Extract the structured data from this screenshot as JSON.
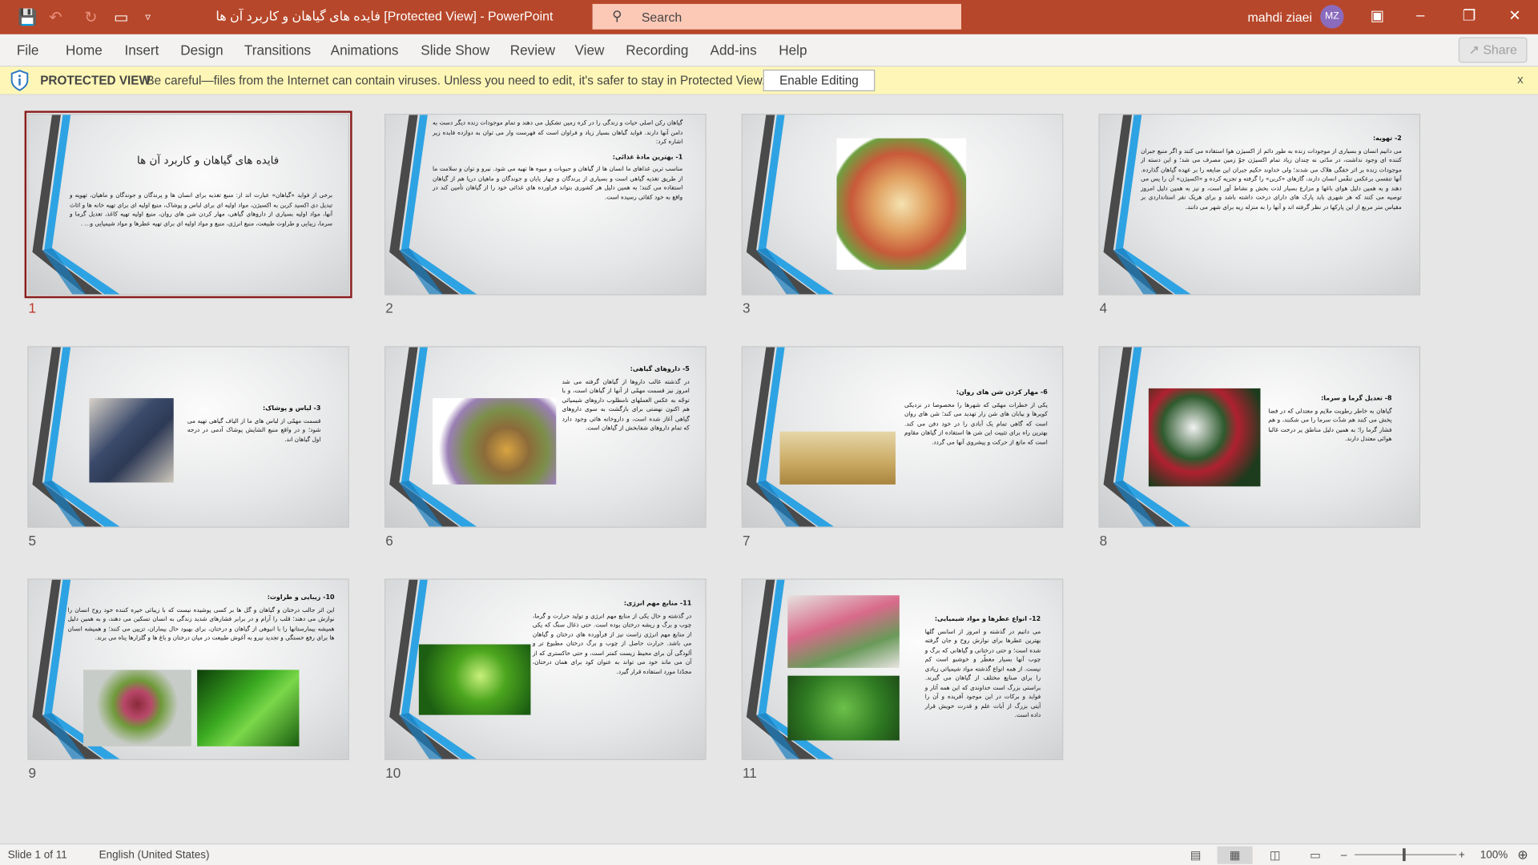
{
  "titlebar": {
    "title": "فایده های گیاهان و کاربرد آن ها [Protected View]  -  PowerPoint",
    "search_placeholder": "Search",
    "user_name": "mahdi ziaei",
    "user_initials": "MZ",
    "accent": "#b7472a"
  },
  "quick_access": {
    "icons": [
      "save-icon",
      "undo-icon",
      "redo-icon",
      "present-icon",
      "customize-icon"
    ]
  },
  "menu": {
    "items": [
      "File",
      "Home",
      "Insert",
      "Design",
      "Transitions",
      "Animations",
      "Slide Show",
      "Review",
      "View",
      "Recording",
      "Add-ins",
      "Help"
    ],
    "share_label": "Share"
  },
  "protected_view": {
    "label": "PROTECTED VIEW",
    "message": "Be careful—files from the Internet can contain viruses. Unless you need to edit, it's safer to stay in Protected View.",
    "enable_label": "Enable Editing",
    "close_label": "x"
  },
  "slides": [
    {
      "number": "1",
      "selected": true,
      "title": "فایده های گیاهان و کاربرد آن ها",
      "heading": "",
      "body": "برخی از فواید «گیاهان» عبارت اند از: منبع تغذیه برای انسان ها و پرندگان و جوندگان و ماهیان، تهویه و تبدیل دی اکسید کربن به اکسیژن، مواد اولیه ای برای لباس و پوشاک، منبع اولیه ای برای تهیه خانه ها و اثاث آنها، مواد اولیه بسیاری از داروهای گیاهی، مهار کردن شن های روان، منبع اولیه تهیه کاغذ، تعدیل گرما و سرما، زیبایی و طراوت طبیعت، منبع انرژی، منبع و مواد اولیه ای برای تهیه عطرها و مواد شیمیایی و... ."
    },
    {
      "number": "2",
      "heading": "1- بهترین مادهٔ غذائی:",
      "intro": "گیاهان رکن اصلی حیات و زندگی را در کره زمین تشکیل می دهند و تمام موجودات زنده دیگر دست به دامن آنها دارند. فواید گیاهان بسیار زیاد و فراوان است که فهرست وار می توان به دوازده فایده زیر اشاره کرد:",
      "body": "مناسب ترین غذاهای ما انسان ها از گیاهان و حبوبات و میوه ها تهیه می شود. نیرو و توان و سلامت ما از طریق تغذیه گیاهی است و بسیاری از پرندگان و چهار پایان و جوندگان و ماهیان دریا هم از گیاهان استفاده می کنند؛ به همین دلیل هر کشوری بتواند فراورده های غذائی خود را از گیاهان تأمین کند در واقع به خود کفائی رسیده است."
    },
    {
      "number": "3",
      "heading": "",
      "body": "",
      "image": "food-wheel-image"
    },
    {
      "number": "4",
      "heading": "2- تهویه:",
      "body": "می دانیم انسان و بسیاری از موجودات زنده به طور دائم از اکسیژن هوا استفاده می کنند و اگر منبع جبران کننده ای وجود نداشت، در مدّتی نه چندان زیاد تمام اکسیژن جوّ زمین مصرف می شد؛ و این دسته از موجودات زنده بر اثر خفگی هلاک می شدند؛ ولی خداوند حکیم جبران این ضایعه را بر عهده گیاهان گذارده. آنها تنفسی برعکس تنفّس انسان دارند، گازهای «کربن» را گرفته و تجزیه کرده و «اکسیژن» آن را پس می دهند و به همین دلیل هوای باغها و مزارع بسیار لذت بخش و نشاط آور است، و نیز به همین دلیل امروز توصیه می کنند که هر شهری باید پارک های دارای درخت داشته باشد و برای هریک نفر استانداردی بر مقیاس متر مربع از این پارکها در نظر گرفته اند و آنها را به منزله ریه برای شهر می دانند."
    },
    {
      "number": "5",
      "heading": "3- لباس و پوشاک:",
      "body": "قسمت مهمّی از لباس های ما از الیاف گیاهی تهیه می شود؛ و در واقع منبع الشاپش پوشاک آدمی در درجه اول گیاهان اند.",
      "image": "clothing-image"
    },
    {
      "number": "6",
      "heading": "5- داروهای گیاهی:",
      "body": "در گذشته غالب داروها از گیاهان گرفته می شد امروز نیز قسمت مهمّی از آنها از گیاهان است، و با توجّه به عکس العملهای نامطلوب داروهای شیمیائی هم اکنون نهضتی برای بازگشت به سوی داروهای گیاهی آغاز شده است، و داروخانه هائی وجود دارد که تمام داروهای شفابخش از گیاهان است.",
      "image": "herbal-medicine-image"
    },
    {
      "number": "7",
      "heading": "6- مهار کردن شن های روان:",
      "body": "یکی از خطرات مهمّی که شهرها را مخصوصا در نزدیکی کویرها و بیابان های شن زار تهدید می کند؛ شن های روان است که گاهی تمام یک آبادی را در خود دفن می کند. بهترین راه برای تثبیت این شن ها استفاده از گیاهان مقاوم است که مانع از حرکت و پیشروی آنها می گردد.",
      "image": "desert-image"
    },
    {
      "number": "8",
      "heading": "8- تعدیل گرما و سرما:",
      "body": "گیاهان به خاطر رطوبت ملایم و معتدلی که در فضا پخش می کنند هم شدّت سرما را می شکنند، و هم فشار گرما را؛ به همین دلیل مناطق پر درخت غالبا هوائی معتدل دارند.",
      "image": "snowy-berries-image"
    },
    {
      "number": "9",
      "heading": "10- زیبایی و طراوت:",
      "body": "این اثر جالب درختان و گیاهان و گل ها بر کسی پوشیده نیست که با زیبائی خیره کننده خود روح انسان را نوازش می دهند؛ قلب را آرام و در برابر فشارهای شدید زندگی به انسان تسکین می دهند، و به همین دلیل همیشه بیمارستانها را با انبوهی از گیاهان و درختان، برای بهبود حال بیماران، تزیین می کنند؛ و همیشه انسان ها برای رفع خستگی و تجدید نیرو به آغوش طبیعت در میان درختان و باغ ها و گلزارها پناه می برند.",
      "image": "fern-and-leaf-images"
    },
    {
      "number": "10",
      "heading": "11- منابع مهم انرژی:",
      "body": "در گذشته و حال یکی از منابع مهم انرژی و تولید حرارت و گرما، چوب و برگ و ریشه درختان بوده است. حتی ذغال سنگ که یکی از منابع مهم انرژی زاست نیز از فرآورده های درختان و گیاهان می باشد. حرارت حاصل از چوب و برگ درختان مطبوع تر و آلودگی آن برای محیط زیست کمتر است، و حتی خاکستری که از آن می ماند خود می تواند به عنوان کود برای همان درختان، مجدّدا مورد استفاده قرار گیرد.",
      "image": "energy-plant-image"
    },
    {
      "number": "11",
      "heading": "12- انواع عطرها و مواد شیمیایی:",
      "body": "می دانیم در گذشته و امروز از اسانس گلها بهترین عطرها برای نوازش روح و جان گرفته شده است؛ و حتی درختانی و گیاهانی که برگ و چوب آنها بسیار معطّر و خوشبو است کم نیست. از همه انواع گذشته مواد شیمیائی زیادی را برای صنایع مختلف از گیاهان می گیرند. براستی بزرگ است خداوندی که این همه آثار و فواید و برکات در این موجود آفریده و آن را آیتی بزرگ از آیات علم و قدرت خویش قرار داده است.",
      "image": "tulips-and-mint-images"
    }
  ],
  "status": {
    "slide_info": "Slide 1 of 11",
    "language": "English (United States)",
    "zoom": "100%",
    "zoom_level": 100,
    "view_active": "slide-sorter"
  }
}
